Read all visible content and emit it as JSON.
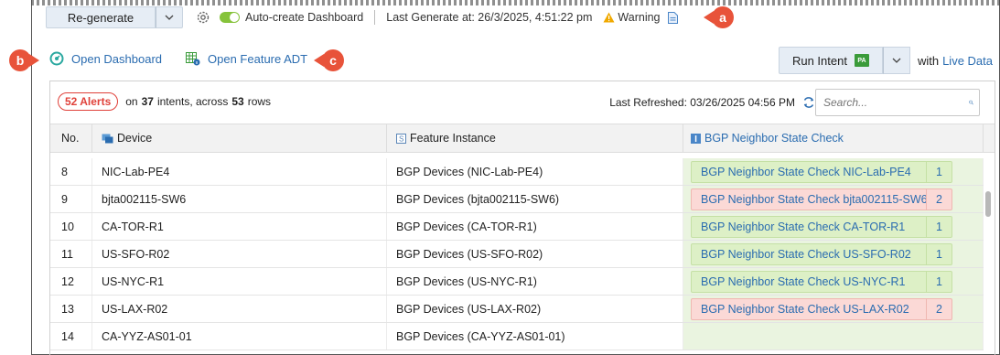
{
  "toolbar": {
    "regenerate_label": "Re-generate",
    "auto_create_label": "Auto-create Dashboard",
    "auto_create_on": true,
    "last_generate": "Last Generate at: 26/3/2025, 4:51:22 pm",
    "warning_label": "Warning"
  },
  "callouts": {
    "a": "a",
    "b": "b",
    "c": "c"
  },
  "actions": {
    "open_dashboard": "Open Dashboard",
    "open_feature_adt": "Open Feature ADT",
    "run_intent": "Run Intent",
    "run_badge": "PA",
    "with_label": "with",
    "live_data": "Live Data"
  },
  "summary": {
    "alerts": "52 Alerts",
    "on": "on",
    "intents_count": "37",
    "intents_text": "intents, across",
    "rows_count": "53",
    "rows_text": "rows",
    "last_refreshed": "Last Refreshed: 03/26/2025 04:56 PM",
    "search_placeholder": "Search..."
  },
  "table": {
    "headers": {
      "no": "No.",
      "device": "Device",
      "feature": "Feature Instance",
      "bgp": "BGP Neighbor State Check"
    },
    "rows": [
      {
        "no": "8",
        "device": "NIC-Lab-PE4",
        "feature": "BGP Devices (NIC-Lab-PE4)",
        "check": "BGP Neighbor State Check NIC-Lab-PE4",
        "count": "1",
        "status": "ok"
      },
      {
        "no": "9",
        "device": "bjta002115-SW6",
        "feature": "BGP Devices (bjta002115-SW6)",
        "check": "BGP Neighbor State Check bjta002115-SW6",
        "count": "2",
        "status": "bad"
      },
      {
        "no": "10",
        "device": "CA-TOR-R1",
        "feature": "BGP Devices (CA-TOR-R1)",
        "check": "BGP Neighbor State Check CA-TOR-R1",
        "count": "1",
        "status": "ok"
      },
      {
        "no": "11",
        "device": "US-SFO-R02",
        "feature": "BGP Devices (US-SFO-R02)",
        "check": "BGP Neighbor State Check US-SFO-R02",
        "count": "1",
        "status": "ok"
      },
      {
        "no": "12",
        "device": "US-NYC-R1",
        "feature": "BGP Devices (US-NYC-R1)",
        "check": "BGP Neighbor State Check US-NYC-R1",
        "count": "1",
        "status": "ok"
      },
      {
        "no": "13",
        "device": "US-LAX-R02",
        "feature": "BGP Devices (US-LAX-R02)",
        "check": "BGP Neighbor State Check US-LAX-R02",
        "count": "2",
        "status": "bad"
      },
      {
        "no": "14",
        "device": "CA-YYZ-AS01-01",
        "feature": "BGP Devices (CA-YYZ-AS01-01)",
        "check": "",
        "count": "",
        "status": "none"
      }
    ]
  },
  "colors": {
    "link": "#2a6cb0",
    "ok_chip": "#ddf0c6",
    "bad_chip": "#fbd9d6",
    "alert": "#e0413a",
    "callout": "#e8533a"
  }
}
